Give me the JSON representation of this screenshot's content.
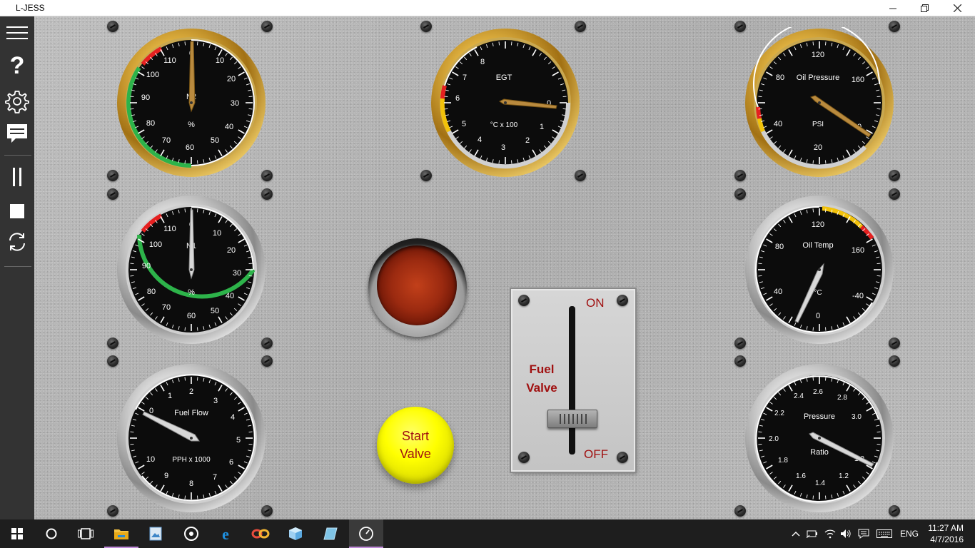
{
  "window": {
    "title": "L-JESS",
    "controls": [
      "minimize",
      "maximize",
      "close"
    ]
  },
  "sidebar": {
    "items": [
      {
        "name": "hamburger-menu-icon"
      },
      {
        "name": "help-icon",
        "glyph": "?"
      },
      {
        "name": "settings-icon"
      },
      {
        "name": "messages-icon"
      },
      {
        "name": "pause-icon"
      },
      {
        "name": "stop-icon"
      },
      {
        "name": "reset-icon"
      }
    ]
  },
  "gauges": {
    "n2": {
      "title": "N2",
      "unit": "%",
      "ticks": [
        "0",
        "10",
        "20",
        "30",
        "40",
        "50",
        "60",
        "70",
        "80",
        "90",
        "100",
        "110"
      ],
      "value": 0,
      "bezel": "brass",
      "arcs": "green 60-100, red 104-118"
    },
    "n1": {
      "title": "N1",
      "unit": "%",
      "ticks": [
        "0",
        "10",
        "20",
        "30",
        "40",
        "50",
        "60",
        "70",
        "80",
        "90",
        "100",
        "110"
      ],
      "value": 0,
      "bezel": "chrome",
      "arcs": "green 30-100, red 104-118"
    },
    "fuel_flow": {
      "title": "Fuel Flow",
      "unit": "PPH x 1000",
      "ticks": [
        "0",
        "1",
        "2",
        "3",
        "4",
        "5",
        "6",
        "7",
        "8",
        "9",
        "10"
      ],
      "value": 0,
      "bezel": "chrome"
    },
    "egt": {
      "title": "EGT",
      "unit": "°C x 100",
      "ticks": [
        "0",
        "1",
        "2",
        "3",
        "4",
        "5",
        "6",
        "7",
        "8"
      ],
      "value": 0,
      "bezel": "brass",
      "arcs": "white 0-5, yellow 5-6, red 6-6.7"
    },
    "oil_pressure": {
      "title": "Oil Pressure",
      "unit": "PSI",
      "ticks": [
        "0",
        "20",
        "40",
        "80",
        "120",
        "160"
      ],
      "value": 0,
      "bezel": "brass",
      "arcs": "white 0-40, yellow 40-45, red 45-55"
    },
    "oil_temp": {
      "title": "Oil Temp",
      "unit": "°C",
      "ticks": [
        "-40",
        "0",
        "40",
        "80",
        "120",
        "160"
      ],
      "value": 15,
      "bezel": "chrome",
      "arcs": "yellow 120-150, red 150-165"
    },
    "pressure_ratio": {
      "title": "Pressure",
      "unit": "Ratio",
      "ticks": [
        "1.0",
        "1.2",
        "1.4",
        "1.6",
        "1.8",
        "2.0",
        "2.2",
        "2.4",
        "2.6",
        "2.8",
        "3.0"
      ],
      "value": 1.0,
      "bezel": "chrome"
    }
  },
  "controls": {
    "start_lamp": {
      "state": "off",
      "color": "#9b2a10"
    },
    "start_button": {
      "line1": "Start",
      "line2": "Valve"
    },
    "fuel_valve": {
      "line1": "Fuel",
      "line2": "Valve",
      "on_label": "ON",
      "off_label": "OFF",
      "position": "off"
    }
  },
  "taskbar": {
    "items": [
      "start-icon",
      "cortana-icon",
      "task-view-icon",
      "file-explorer-icon",
      "photos-app-icon",
      "groove-music-icon",
      "edge-icon",
      "infinity-app-icon",
      "3d-cube-app-icon",
      "glass-app-icon",
      "l-jess-app-icon"
    ],
    "active": "l-jess-app-icon",
    "language": "ENG",
    "time": "11:27 AM",
    "date": "4/7/2016"
  },
  "colors": {
    "panel": "#b4b4b4",
    "sidebar": "#333333",
    "label_red": "#a01010",
    "arc_green": "#2db34a",
    "arc_red": "#e52020",
    "arc_yellow": "#f2c20a"
  }
}
